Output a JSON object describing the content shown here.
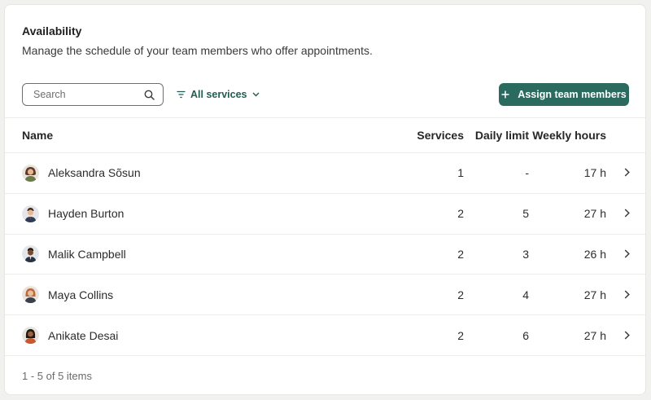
{
  "panel": {
    "title": "Availability",
    "subtitle": "Manage the schedule of your team members who offer appointments."
  },
  "toolbar": {
    "search_placeholder": "Search",
    "search_value": "",
    "filter_label": "All services",
    "assign_label": "Assign team members"
  },
  "table": {
    "headers": {
      "name": "Name",
      "services": "Services",
      "daily_limit": "Daily limit",
      "weekly_hours": "Weekly hours"
    },
    "rows": [
      {
        "name": "Aleksandra Sõsun",
        "services": "1",
        "daily_limit": "-",
        "weekly_hours": "17 h"
      },
      {
        "name": "Hayden Burton",
        "services": "2",
        "daily_limit": "5",
        "weekly_hours": "27 h"
      },
      {
        "name": "Malik Campbell",
        "services": "2",
        "daily_limit": "3",
        "weekly_hours": "26 h"
      },
      {
        "name": "Maya Collins",
        "services": "2",
        "daily_limit": "4",
        "weekly_hours": "27 h"
      },
      {
        "name": "Anikate Desai",
        "services": "2",
        "daily_limit": "6",
        "weekly_hours": "27 h"
      }
    ]
  },
  "footer": {
    "pagination": "1 - 5 of 5 items"
  },
  "colors": {
    "accent": "#2a6a5f",
    "link": "#1f5c52"
  },
  "icons": [
    "search-icon",
    "filter-icon",
    "chevron-down-icon",
    "plus-icon",
    "chevron-right-icon"
  ]
}
